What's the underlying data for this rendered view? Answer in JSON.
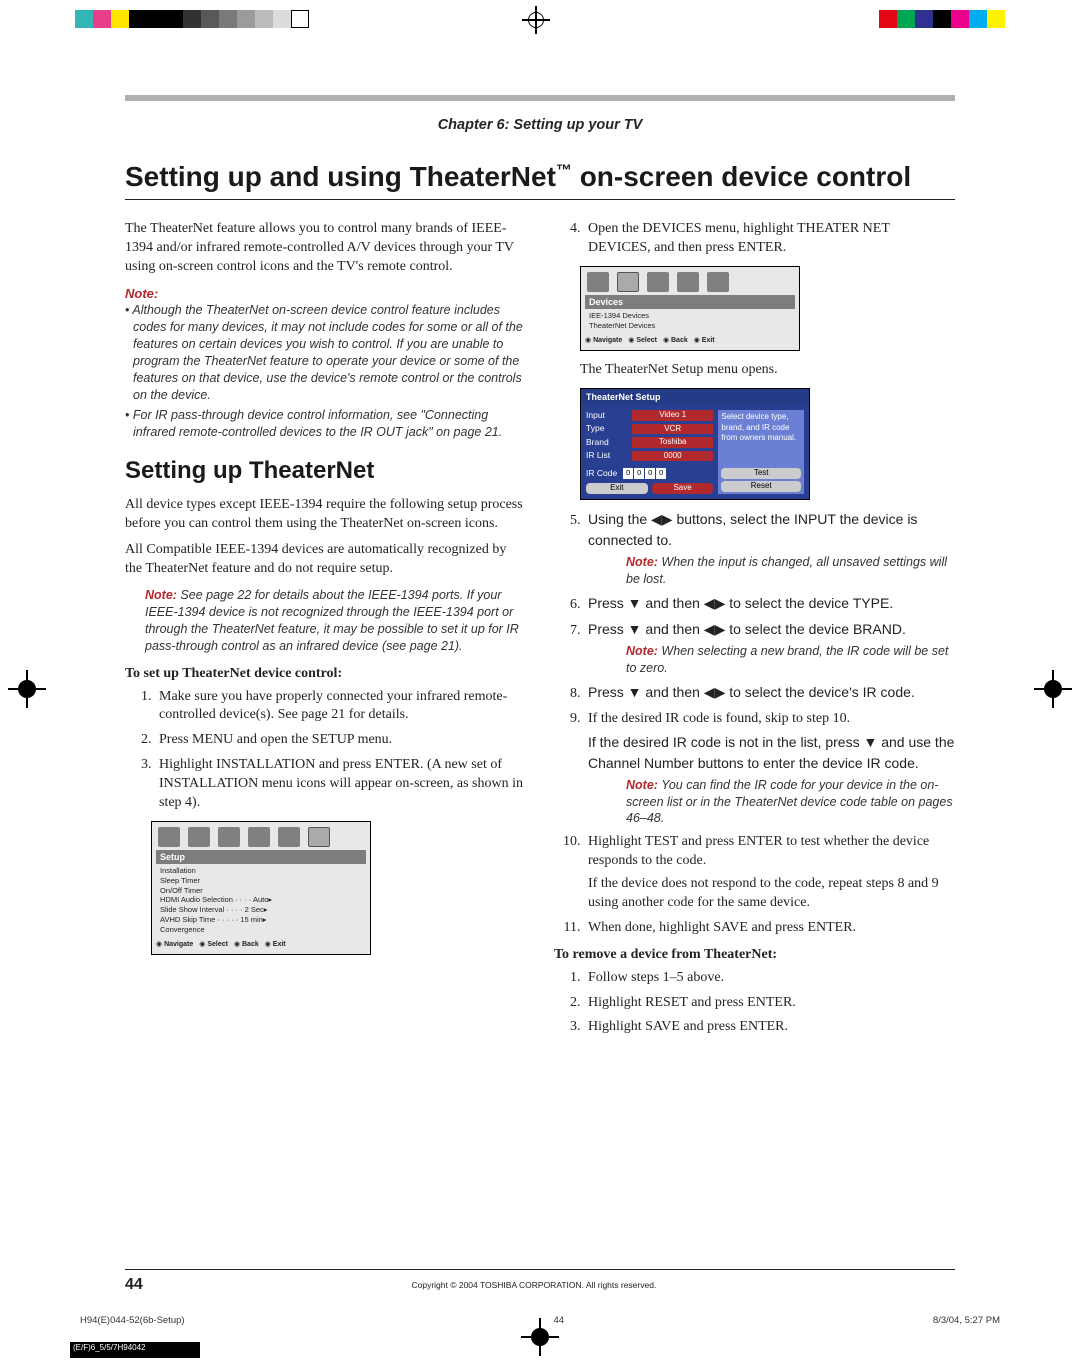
{
  "chapter": "Chapter 6: Setting up your TV",
  "title_pre": "Setting up and using TheaterNet",
  "title_tm": "™",
  "title_post": " on-screen device control",
  "intro": "The TheaterNet feature allows you to control many brands of IEEE-1394 and/or infrared remote-controlled A/V devices through your TV using on-screen control icons and the TV's remote control.",
  "notehead": "Note:",
  "notes": [
    "Although the TheaterNet on-screen device control feature includes codes for many devices, it may not include codes for some or all of the features on certain devices you wish to control. If you are unable to program the TheaterNet feature to operate your device or some of the features on that device, use the device's remote control or the controls on the device.",
    "For IR pass-through device control information, see \"Connecting infrared remote-controlled devices to the IR OUT jack\" on page 21."
  ],
  "h2": "Setting up TheaterNet",
  "para_setup1": "All device types except IEEE-1394 require the following setup process before you can control them using the TheaterNet on-screen icons.",
  "para_setup2": "All Compatible IEEE-1394 devices are automatically recognized by the TheaterNet feature and do not require setup.",
  "indent_note": " See page 22 for details about the IEEE-1394 ports. If your IEEE-1394 device is not recognized through the IEEE-1394 port or through the TheaterNet feature, it may be possible to set it up for IR pass-through control as an infrared device (see page 21).",
  "tosetup": "To set up TheaterNet device control:",
  "steps_left": [
    "Make sure you have properly connected your infrared remote-controlled device(s). See page 21 for details.",
    "Press MENU and open the SETUP menu.",
    "Highlight INSTALLATION and press ENTER. (A new set of INSTALLATION menu icons will appear on-screen, as shown in step 4)."
  ],
  "setup_menu": {
    "tab": "Setup",
    "items": [
      "Installation",
      "Sleep Timer",
      "On/Off Timer",
      "HDMI Audio Selection · · · · Auto▸",
      "Slide Show Interval · · · ·  2 Sec▸",
      "AVHD Skip Time · · · · · 15 min▸",
      "Convergence"
    ],
    "nav": [
      "Navigate",
      "Select",
      "Back",
      "Exit"
    ]
  },
  "step4": "Open the DEVICES menu, highlight THEATER NET DEVICES, and then press ENTER.",
  "devices_menu": {
    "tab": "Devices",
    "items": [
      "IEE-1394 Devices",
      "TheaterNet Devices"
    ],
    "nav": [
      "Navigate",
      "Select",
      "Back",
      "Exit"
    ]
  },
  "tn_caption": "The TheaterNet Setup menu opens.",
  "tn_setup": {
    "title": "TheaterNet Setup",
    "help": "Select device type, brand, and IR code from owners manual.",
    "rows": {
      "Input": "Video 1",
      "Type": "VCR",
      "Brand": "Toshiba",
      "IR List": "0000"
    },
    "ircode_label": "IR Code",
    "ircode_digits": [
      "0",
      "0",
      "0",
      "0"
    ],
    "test": "Test",
    "exit": "Exit",
    "save": "Save",
    "reset": "Reset"
  },
  "steps_right": {
    "5": "Using the ◀▶ buttons, select the INPUT the device is connected to.",
    "5note": " When the input is changed, all unsaved settings will be lost.",
    "6": "Press ▼ and then ◀▶ to select the device TYPE.",
    "7": "Press ▼ and then ◀▶ to select the device BRAND.",
    "7note": " When selecting a new brand, the IR code will be set to zero.",
    "8": "Press ▼ and then ◀▶ to select the device's IR code.",
    "9a": "If the desired IR code is found, skip to step 10.",
    "9b": "If the desired IR code is not in the list, press ▼ and use the Channel Number buttons to enter the device IR code.",
    "9note": " You can find the IR code for your device in the on-screen list or in the TheaterNet device code table on pages 46–48.",
    "10a": "Highlight TEST and press ENTER to test whether the device responds to the code.",
    "10b": "If the device does not respond to the code, repeat steps 8 and 9 using another code for the same device.",
    "11": "When done, highlight SAVE and press ENTER."
  },
  "toremove": "To remove a device from TheaterNet:",
  "remove_steps": [
    "Follow steps 1–5 above.",
    "Highlight RESET and press ENTER.",
    "Highlight SAVE and press ENTER."
  ],
  "page_number": "44",
  "copyright": "Copyright © 2004 TOSHIBA CORPORATION. All rights reserved.",
  "fileinfo_left": "H94(E)044-52(6b-Setup)",
  "fileinfo_mid": "44",
  "fileinfo_right": "8/3/04, 5:27 PM",
  "blackstrip": "(E/F)6_5/5/7H94042",
  "swatch_colors_left": [
    "#32b6b6",
    "#e83f8c",
    "#ffe600",
    "#000",
    "#000",
    "#000",
    "#323232",
    "#595959",
    "#7a7a7a",
    "#9b9b9b",
    "#bcbcbc",
    "#dcdcdc",
    "#fff"
  ],
  "swatch_colors_right": [
    "#e30613",
    "#00a651",
    "#2e3192",
    "#000",
    "#ec008c",
    "#00aeef",
    "#fff200"
  ]
}
